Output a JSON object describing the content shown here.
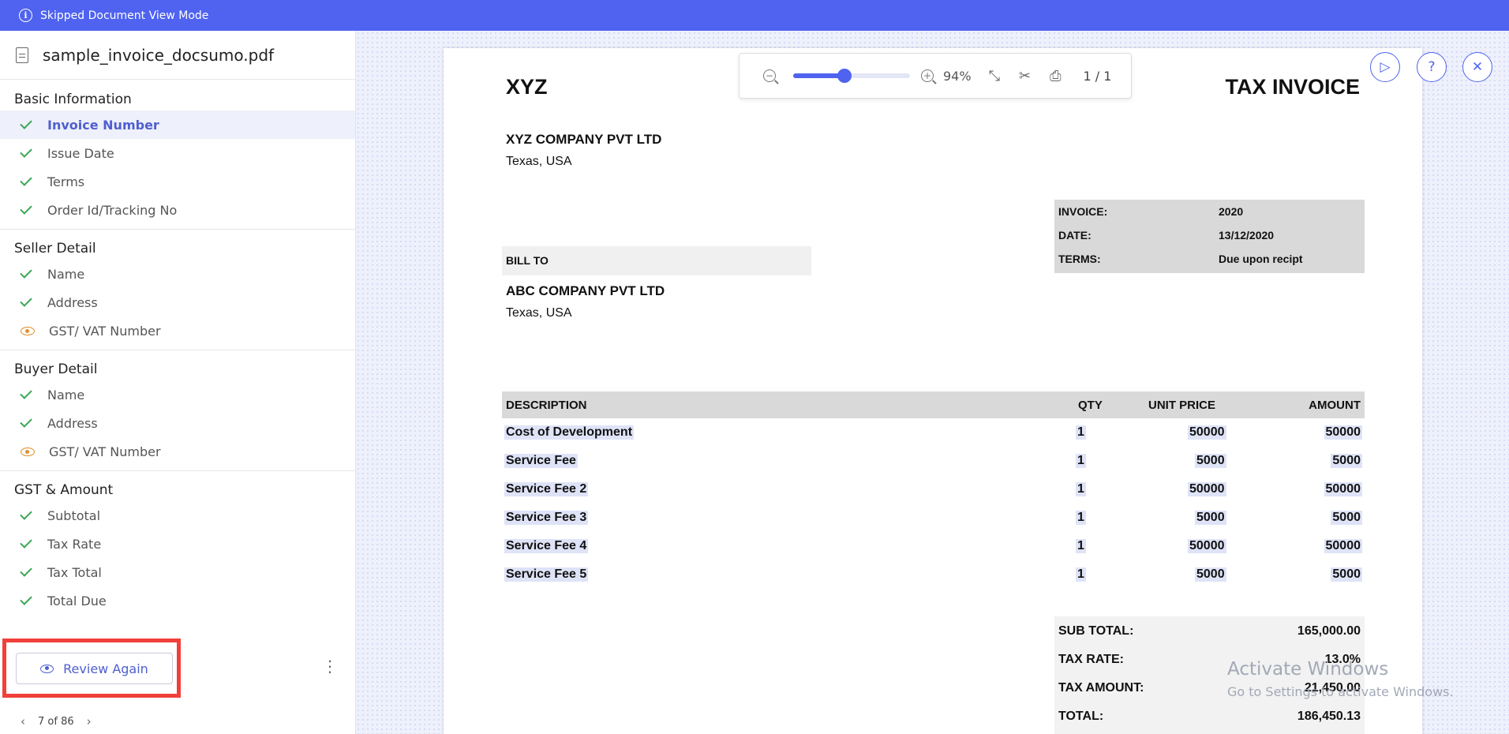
{
  "banner": {
    "text": "Skipped Document View Mode"
  },
  "file": {
    "name": "sample_invoice_docsumo.pdf"
  },
  "sections": {
    "basic": {
      "title": "Basic Information",
      "fields": [
        "Invoice Number",
        "Issue Date",
        "Terms",
        "Order Id/Tracking No"
      ]
    },
    "seller": {
      "title": "Seller Detail",
      "fields": [
        "Name",
        "Address",
        "GST/ VAT Number"
      ]
    },
    "buyer": {
      "title": "Buyer Detail",
      "fields": [
        "Name",
        "Address",
        "GST/ VAT Number"
      ]
    },
    "gst": {
      "title": "GST & Amount",
      "fields": [
        "Subtotal",
        "Tax Rate",
        "Tax Total",
        "Total Due"
      ]
    }
  },
  "review": {
    "label": "Review Again"
  },
  "pager": {
    "label": "7 of 86"
  },
  "toolbar": {
    "zoom": "94%",
    "zoom_level": 0.44,
    "page": "1 / 1"
  },
  "invoice": {
    "company_short": "XYZ",
    "doc_title": "TAX INVOICE",
    "company_name": "XYZ COMPANY PVT LTD",
    "company_addr": "Texas, USA",
    "meta": {
      "invoice_label": "INVOICE:",
      "invoice_value": "2020",
      "date_label": "DATE:",
      "date_value": "13/12/2020",
      "terms_label": "TERMS:",
      "terms_value": "Due upon recipt"
    },
    "bill_to_label": "BILL TO",
    "buyer_name": "ABC COMPANY PVT LTD",
    "buyer_addr": "Texas, USA",
    "table_headers": {
      "description": "DESCRIPTION",
      "qty": "QTY",
      "unit_price": "UNIT PRICE",
      "amount": "AMOUNT"
    },
    "items": [
      {
        "desc": "Cost of Development",
        "qty": "1",
        "unit": "50000",
        "amount": "50000"
      },
      {
        "desc": "Service Fee",
        "qty": "1",
        "unit": "5000",
        "amount": "5000"
      },
      {
        "desc": "Service Fee 2",
        "qty": "1",
        "unit": "50000",
        "amount": "50000"
      },
      {
        "desc": "Service Fee 3",
        "qty": "1",
        "unit": "5000",
        "amount": "5000"
      },
      {
        "desc": "Service Fee 4",
        "qty": "1",
        "unit": "50000",
        "amount": "50000"
      },
      {
        "desc": "Service Fee 5",
        "qty": "1",
        "unit": "5000",
        "amount": "5000"
      }
    ],
    "totals": {
      "sub_label": "SUB TOTAL:",
      "sub_value": "165,000.00",
      "rate_label": "TAX RATE:",
      "rate_value": "13.0%",
      "tax_label": "TAX AMOUNT:",
      "tax_value": "21,450.00",
      "total_label": "TOTAL:",
      "total_value": "186,450.13"
    }
  },
  "watermark": {
    "line1": "Activate Windows",
    "line2": "Go to Settings to activate Windows."
  },
  "colors": {
    "accent": "#4f63f0",
    "check": "#3aa655",
    "review_warning": "#e0902a",
    "highlight_border": "#f1403a"
  }
}
